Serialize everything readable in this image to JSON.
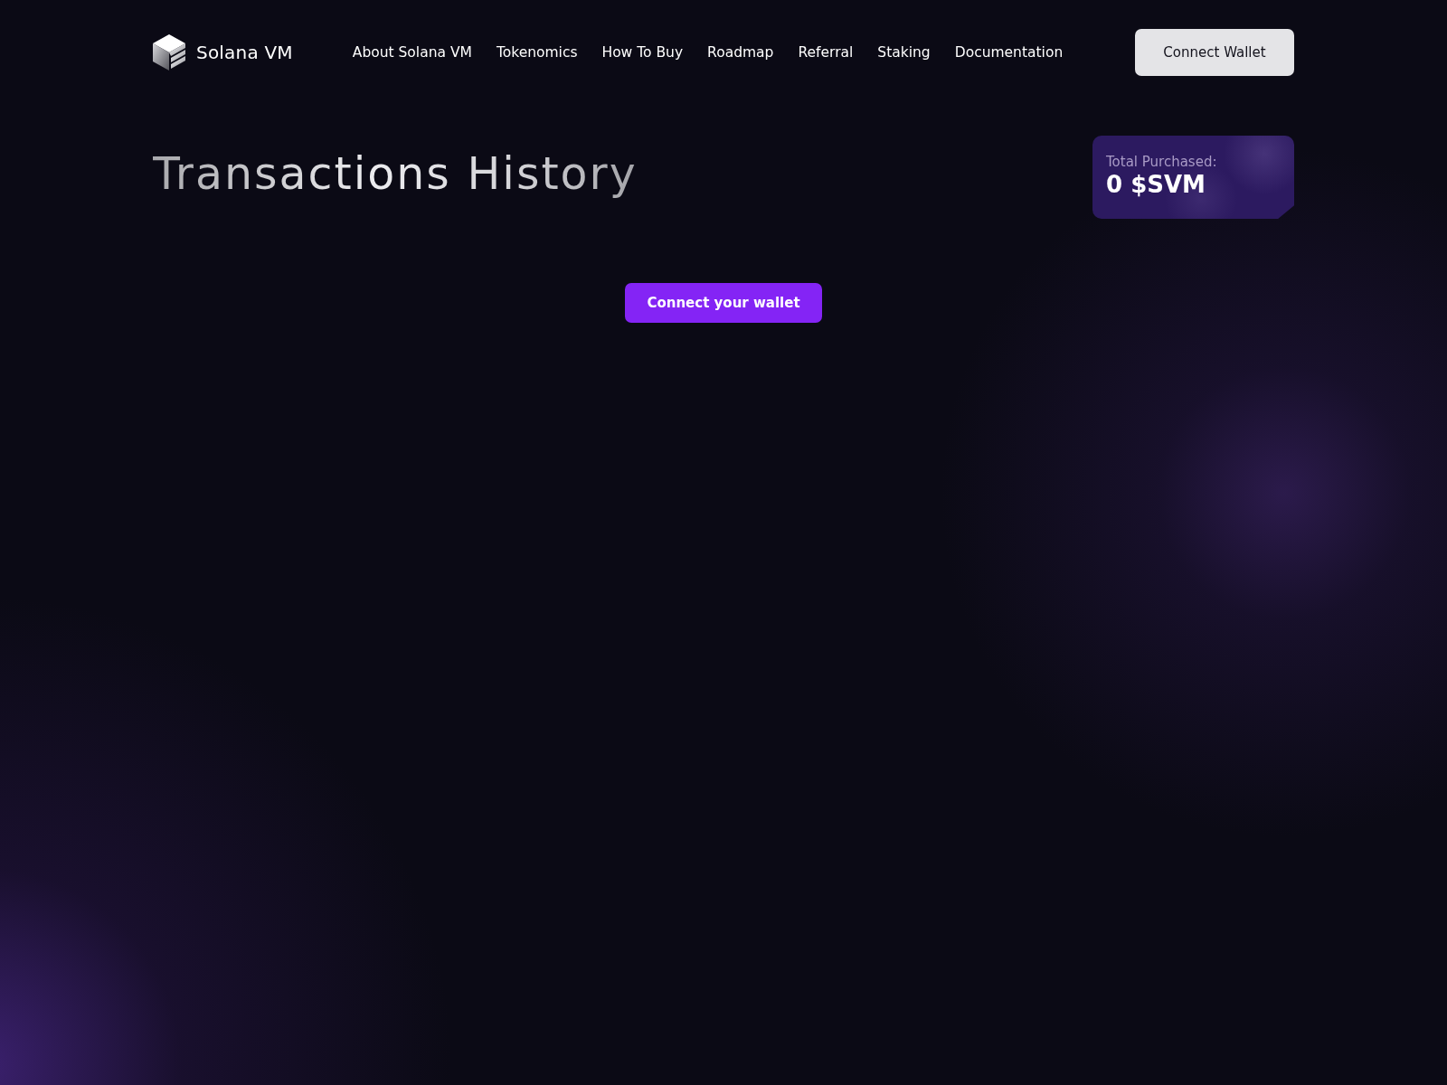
{
  "brand": {
    "name": "Solana VM"
  },
  "nav": {
    "items": [
      "About Solana VM",
      "Tokenomics",
      "How To Buy",
      "Roadmap",
      "Referral",
      "Staking",
      "Documentation"
    ]
  },
  "header_button": {
    "label": "Connect Wallet"
  },
  "page": {
    "title": "Transactions History"
  },
  "summary_card": {
    "label": "Total Purchased:",
    "value": "0 $SVM"
  },
  "connect_prompt": {
    "button": "Connect your wallet"
  }
}
